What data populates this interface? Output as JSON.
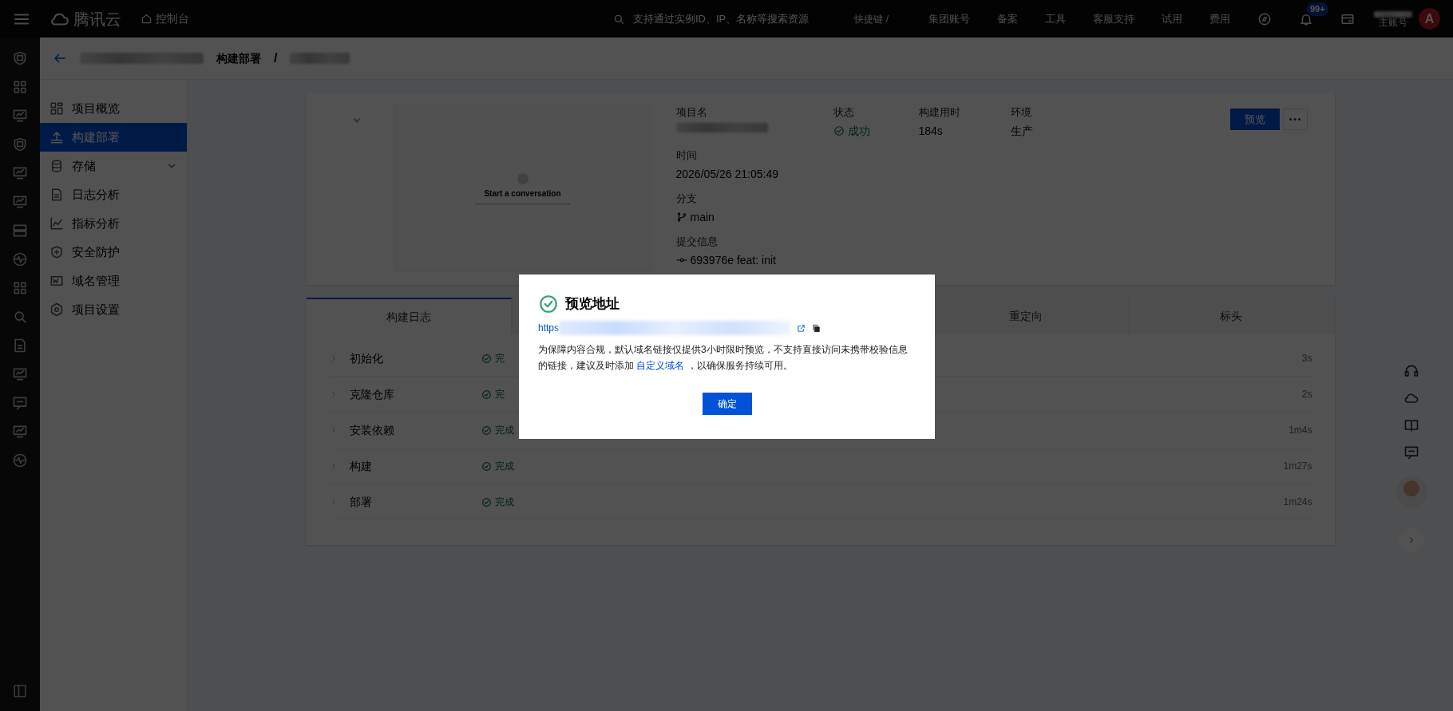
{
  "topbar": {
    "brand": "腾讯云",
    "console": "控制台",
    "search": {
      "placeholder": "支持通过实例ID、IP、名称等搜索资源"
    },
    "shortcut": "快捷键 /",
    "menu": [
      "集团账号",
      "备案",
      "工具",
      "客服支持",
      "试用",
      "费用"
    ],
    "notification_badge": "99+",
    "account_label": "主账号",
    "avatar_letter": "A"
  },
  "breadcrumb": {
    "current": "构建部署",
    "separator": "/"
  },
  "sidebar": {
    "items": [
      {
        "label": "项目概览",
        "selected": false,
        "expandable": false
      },
      {
        "label": "构建部署",
        "selected": true,
        "expandable": false
      },
      {
        "label": "存储",
        "selected": false,
        "expandable": true
      },
      {
        "label": "日志分析",
        "selected": false,
        "expandable": false
      },
      {
        "label": "指标分析",
        "selected": false,
        "expandable": false
      },
      {
        "label": "安全防护",
        "selected": false,
        "expandable": false
      },
      {
        "label": "域名管理",
        "selected": false,
        "expandable": false
      },
      {
        "label": "项目设置",
        "selected": false,
        "expandable": false
      }
    ]
  },
  "project": {
    "thumbnail": {
      "heading": "Start a conversation"
    },
    "summary": [
      {
        "label": "项目名",
        "kind": "blurred"
      },
      {
        "label": "状态",
        "kind": "status",
        "value": "成功"
      },
      {
        "label": "构建用时",
        "kind": "text",
        "value": "184s"
      },
      {
        "label": "环境",
        "kind": "text",
        "value": "生产"
      }
    ],
    "details": [
      {
        "label": "时间",
        "kind": "text",
        "value": "2026/05/26 21:05:49"
      },
      {
        "label": "分支",
        "kind": "branch",
        "value": "main"
      },
      {
        "label": "提交信息",
        "kind": "commit",
        "value": "693976e feat: init"
      }
    ],
    "preview_button": "预览"
  },
  "tabs": [
    {
      "label": "构建日志",
      "selected": true
    },
    {
      "label": "重定向",
      "selected": false
    },
    {
      "label": "标头",
      "selected": false
    }
  ],
  "steps": [
    {
      "name": "初始化",
      "status": "完",
      "duration": "3s"
    },
    {
      "name": "克隆仓库",
      "status": "完",
      "duration": "2s"
    },
    {
      "name": "安装依赖",
      "status": "完成",
      "duration": "1m4s"
    },
    {
      "name": "构建",
      "status": "完成",
      "duration": "1m27s"
    },
    {
      "name": "部署",
      "status": "完成",
      "duration": "1m24s"
    }
  ],
  "dialog": {
    "title": "预览地址",
    "url_prefix": "https",
    "notice_before": "为保障内容合规，默认域名链接仅提供3小时限时预览，不支持直接访问未携带校验信息的链接，建议及时添加 ",
    "link": "自定义域名",
    "notice_after": " ，以确保服务持续可用。",
    "ok_button": "确定"
  }
}
